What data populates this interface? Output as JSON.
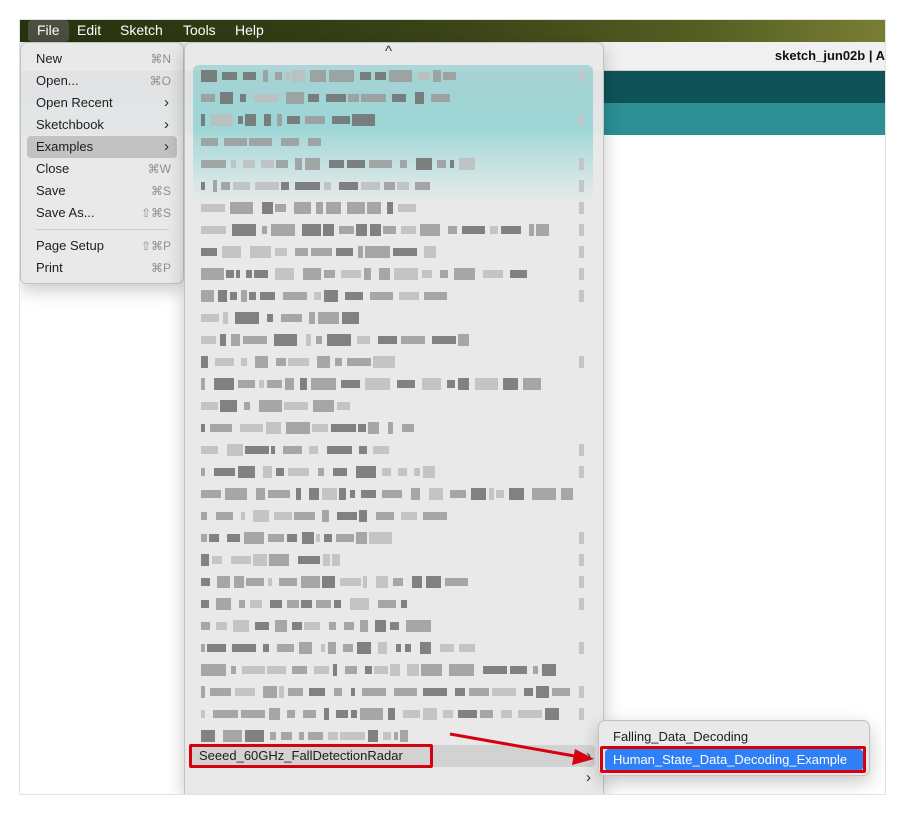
{
  "menubar": {
    "items": [
      "File",
      "Edit",
      "Sketch",
      "Tools",
      "Help"
    ]
  },
  "window": {
    "title": "sketch_jun02b | A"
  },
  "file_menu": {
    "items": [
      {
        "label": "New",
        "shortcut": "⌘N"
      },
      {
        "label": "Open...",
        "shortcut": "⌘O"
      },
      {
        "label": "Open Recent",
        "submenu": "›"
      },
      {
        "label": "Sketchbook",
        "submenu": "›"
      },
      {
        "label": "Examples",
        "submenu": "›",
        "selected": true
      },
      {
        "label": "Close",
        "shortcut": "⌘W"
      },
      {
        "label": "Save",
        "shortcut": "⌘S"
      },
      {
        "label": "Save As...",
        "shortcut": "⇧⌘S"
      },
      {
        "label": "Page Setup",
        "shortcut": "⇧⌘P"
      },
      {
        "label": "Print",
        "shortcut": "⌘P"
      }
    ]
  },
  "examples_menu": {
    "scroll_up_icon": "^",
    "selected_item": {
      "label": "Seeed_60GHz_FallDetectionRadar",
      "arrow": "›"
    },
    "more_arrows": [
      "›",
      "›"
    ]
  },
  "submenu": {
    "items": [
      {
        "label": "Falling_Data_Decoding"
      },
      {
        "label": "Human_State_Data_Decoding_Example",
        "selected": true
      }
    ]
  },
  "colors": {
    "highlight_red": "#d70010",
    "selection_blue": "#2f7ff6",
    "toolbar_teal": "#0f5357",
    "tab_teal": "#2b8f95"
  }
}
